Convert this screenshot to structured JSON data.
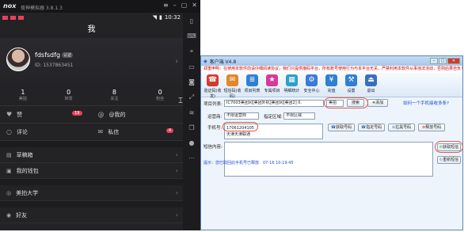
{
  "emulator": {
    "brand": "nox",
    "version": "夜神模拟器 3.8.1.3",
    "sidebar_icons": [
      "phone-icon",
      "keyboard-icon",
      "location-icon",
      "screen-icon",
      "camera-icon",
      "expand-icon",
      "shake-icon",
      "multi-icon",
      "record-icon",
      "more-icon"
    ]
  },
  "statusbar": {
    "time": "10:32"
  },
  "header": {
    "title": "我"
  },
  "profile": {
    "name": "fdsfsdfg",
    "badge": "认证",
    "id": "ID: 1537863451",
    "arrow": "›"
  },
  "stats": [
    {
      "n": "1",
      "l": "美拍"
    },
    {
      "n": "0",
      "l": "转发"
    },
    {
      "n": "8",
      "l": "关注"
    },
    {
      "n": "0",
      "l": "粉丝"
    }
  ],
  "row1": [
    {
      "icon": "♥",
      "label": "赞",
      "badge": "19"
    },
    {
      "icon": "@",
      "label": "@我的",
      "badge": ""
    }
  ],
  "row2": [
    {
      "icon": "○",
      "label": "评论",
      "badge": ""
    },
    {
      "icon": "✉",
      "label": "私信",
      "badge": "4"
    }
  ],
  "menu1": [
    {
      "icon": "▤",
      "label": "草稿箱"
    },
    {
      "icon": "▣",
      "label": "我的钱包"
    }
  ],
  "menu2": [
    {
      "icon": "◎",
      "label": "美拍大学"
    }
  ],
  "menu3": [
    {
      "icon": "◉",
      "label": "好友"
    }
  ],
  "app": {
    "title": "客户端 V4.8",
    "notice": "郑重申明：在使用本软件前请仔细阅读协议，我们只提供接码平台，所有账号使用行为与本平台无关，严禁利用本软件从事违法活动，否则后果自负！！！",
    "toolbar": [
      {
        "label": "验证码(收发)",
        "icon": "☎",
        "color": "#d53a2f"
      },
      {
        "label": "短信码(收码)",
        "icon": "✉",
        "color": "#e0882a"
      },
      {
        "label": "项目列表",
        "icon": "≣",
        "color": "#2f7fd3"
      },
      {
        "label": "专属项目",
        "icon": "★",
        "color": "#d63a9a"
      },
      {
        "label": "明细统计",
        "icon": "▦",
        "color": "#2f9fc8"
      },
      {
        "label": "安全中心",
        "icon": "⚙",
        "color": "#3b7ad8"
      },
      {
        "label": "充值",
        "icon": "¥",
        "color": "#2f7fd3"
      },
      {
        "label": "设置",
        "icon": "⚒",
        "color": "#2f7fd3"
      },
      {
        "label": "退出",
        "icon": "⏏",
        "color": "#3a6fc0"
      }
    ],
    "project_label": "项目列表:",
    "project_value": "IC7003美团冈[美团外机]美团冈[美团2] 0.",
    "search_value": "美拍",
    "search_btn": "搜索",
    "add_btn": "添加",
    "help_link": "如何一个手机接收多条?",
    "operator_label": "运营商:",
    "operator_value": "不限运营商",
    "region_label": "指定区域:",
    "region_value": "不限区域",
    "phone_label": "手机号:",
    "phone_lines": [
      "17061204105",
      "天津天津联通"
    ],
    "get_btn": "获取号码",
    "assign_btn": "指定号码",
    "pull_btn": "拉黑号码",
    "release_btn": "释放号码",
    "sms_label": "短信内容:",
    "fetch_btn": "获取短信",
    "resend_btn": "重新短信",
    "status": "提示：您已取回此手机号已释放　07-16 10:19:45"
  }
}
